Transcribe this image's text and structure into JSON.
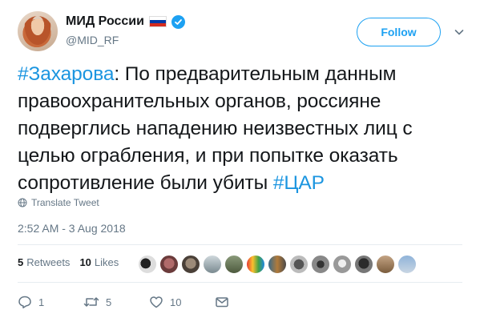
{
  "header": {
    "display_name": "МИД России",
    "handle": "@MID_RF",
    "follow_label": "Follow"
  },
  "tweet": {
    "hashtag1": "#Захарова",
    "body": ": По предварительным данным правоохранительных органов, россияне подверглись нападению неизвестных лиц с целью ограбления, и при попытке оказать сопротивление были убиты ",
    "hashtag2": "#ЦАР",
    "translate_label": "Translate Tweet",
    "timestamp": "2:52 AM - 3 Aug 2018"
  },
  "stats": {
    "retweets_count": "5",
    "retweets_label": "Retweets",
    "likes_count": "10",
    "likes_label": "Likes"
  },
  "actions": {
    "reply_count": "1",
    "retweet_count": "5",
    "like_count": "10"
  },
  "colors": {
    "accent": "#1da1f2",
    "hashtag": "#1b95e0",
    "muted": "#657786"
  },
  "icons": [
    "verified-badge-icon",
    "russia-flag-icon",
    "chevron-down-icon",
    "globe-icon",
    "reply-icon",
    "retweet-icon",
    "heart-icon",
    "message-icon"
  ]
}
